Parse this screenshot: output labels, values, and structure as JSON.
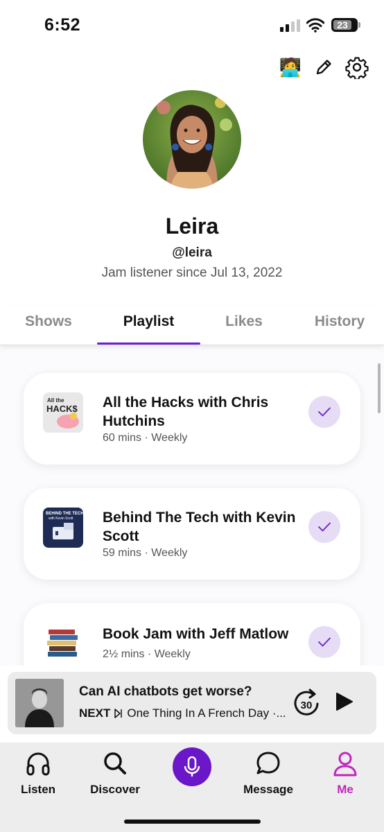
{
  "status_bar": {
    "time": "6:52",
    "battery": "23"
  },
  "header": {
    "icons": [
      "technologist-emoji-icon",
      "pencil-icon",
      "gear-icon"
    ],
    "emoji": "🧑‍💻"
  },
  "profile": {
    "name": "Leira",
    "handle": "@leira",
    "since": "Jam listener since Jul 13, 2022"
  },
  "tabs": [
    {
      "label": "Shows",
      "active": false
    },
    {
      "label": "Playlist",
      "active": true
    },
    {
      "label": "Likes",
      "active": false
    },
    {
      "label": "History",
      "active": false
    }
  ],
  "accent_color": "#6a1fd0",
  "active_nav_color": "#c224c0",
  "playlist": [
    {
      "title": "All the Hacks with Chris Hutchins",
      "meta": "60 mins · Weekly",
      "checked": true,
      "thumb_text": "All the HACK$"
    },
    {
      "title": "Behind The Tech with Kevin Scott",
      "meta": "59 mins · Weekly",
      "checked": true,
      "thumb_text": "BEHIND THE TECH with Kevin Scott"
    },
    {
      "title": "Book Jam with Jeff Matlow",
      "meta": "2½ mins · Weekly",
      "checked": true
    }
  ],
  "mini_player": {
    "title": "Can AI chatbots get worse?",
    "next_label": "NEXT",
    "next_title": "One Thing In A French Day ·...",
    "skip_seconds": "30"
  },
  "bottom_nav": [
    {
      "label": "Listen",
      "icon": "headphones-icon",
      "active": false
    },
    {
      "label": "Discover",
      "icon": "search-icon",
      "active": false
    },
    {
      "label": "",
      "icon": "microphone-icon",
      "active": false
    },
    {
      "label": "Message",
      "icon": "chat-bubble-icon",
      "active": false
    },
    {
      "label": "Me",
      "icon": "person-icon",
      "active": true
    }
  ]
}
